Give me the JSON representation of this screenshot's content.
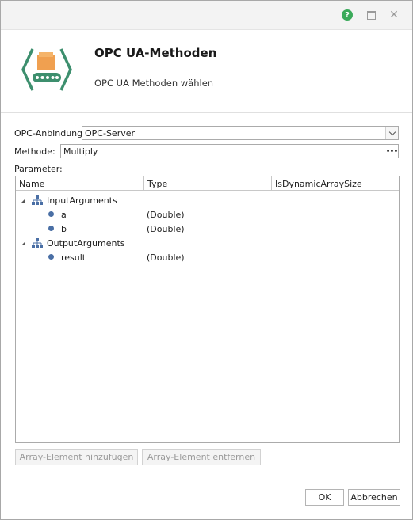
{
  "header": {
    "title": "OPC UA-Methoden",
    "subtitle": "OPC UA Methoden wählen"
  },
  "form": {
    "connection_label": "OPC-Anbindung:",
    "connection_value": "OPC-Server",
    "method_label": "Methode:",
    "method_value": "Multiply",
    "params_label": "Parameter:"
  },
  "grid": {
    "columns": [
      "Name",
      "Type",
      "IsDynamicArraySize"
    ],
    "rows": [
      {
        "name": "InputArguments",
        "type": "",
        "dyn": ""
      },
      {
        "name": "a",
        "type": "(Double)",
        "dyn": ""
      },
      {
        "name": "b",
        "type": "(Double)",
        "dyn": ""
      },
      {
        "name": "OutputArguments",
        "type": "",
        "dyn": ""
      },
      {
        "name": "result",
        "type": "(Double)",
        "dyn": ""
      }
    ]
  },
  "buttons": {
    "add_element": "Array-Element hinzufügen",
    "remove_element": "Array-Element entfernen",
    "ok": "OK",
    "cancel": "Abbrechen"
  },
  "titlebar": {
    "help": "?"
  },
  "colors": {
    "help_green": "#3aaa5a",
    "logo_green": "#3d8f6e",
    "logo_orange": "#f0a050",
    "dot_blue": "#4a6fa5"
  }
}
